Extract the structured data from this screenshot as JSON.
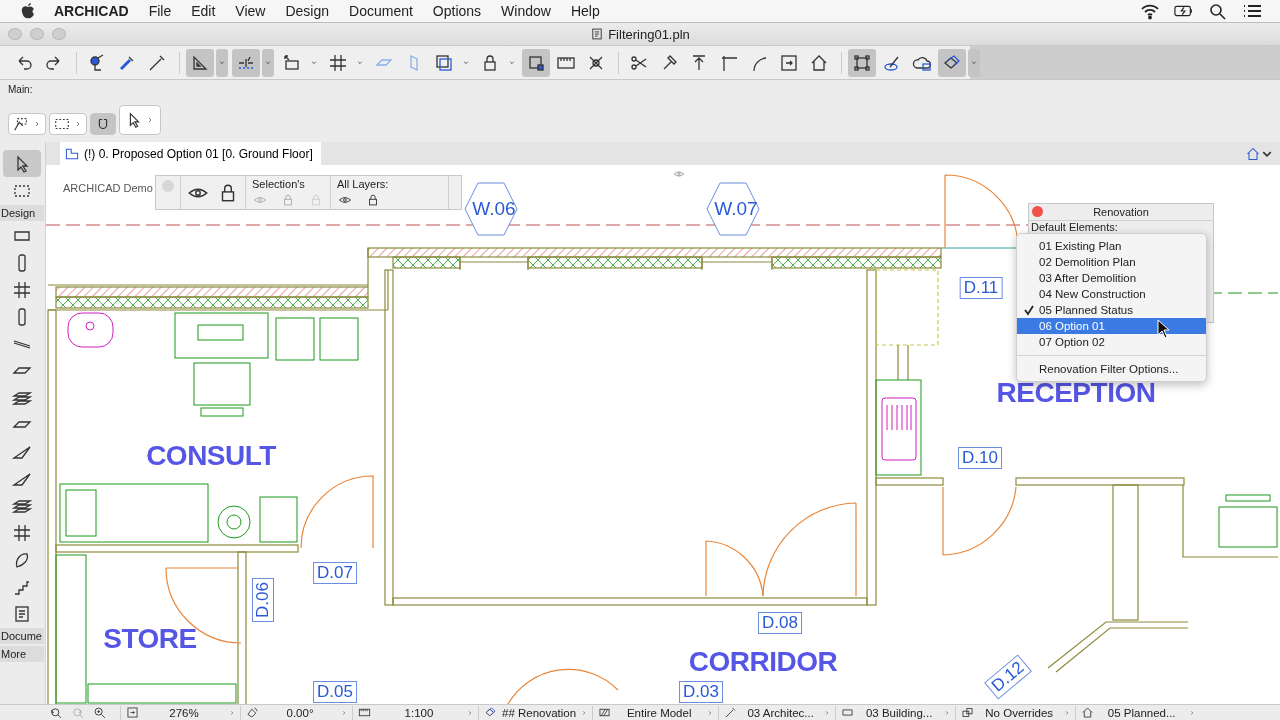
{
  "menu_bar": {
    "app_name": "ARCHICAD",
    "items": [
      "File",
      "Edit",
      "View",
      "Design",
      "Document",
      "Options",
      "Window",
      "Help"
    ]
  },
  "window": {
    "title": "Filtering01.pln"
  },
  "toolbar": {
    "buttons": [
      {
        "on": false,
        "has_menu": false
      },
      {
        "on": false,
        "has_menu": false
      },
      {
        "on": false,
        "has_menu": false
      },
      {
        "on": false,
        "has_menu": false
      },
      {
        "on": false,
        "has_menu": false
      },
      {
        "on": true,
        "has_menu": true
      },
      {
        "on": true,
        "has_menu": true
      },
      {
        "on": false,
        "has_menu": true
      },
      {
        "on": false,
        "has_menu": true
      },
      {
        "on": false,
        "has_menu": false
      },
      {
        "on": false,
        "has_menu": false
      },
      {
        "on": false,
        "has_menu": true
      },
      {
        "on": false,
        "has_menu": true
      },
      {
        "on": true,
        "has_menu": false
      },
      {
        "on": false,
        "has_menu": false
      },
      {
        "on": false,
        "has_menu": false
      },
      {
        "on": false,
        "has_menu": false
      },
      {
        "on": false,
        "has_menu": false
      },
      {
        "on": false,
        "has_menu": false
      },
      {
        "on": false,
        "has_menu": false
      },
      {
        "on": false,
        "has_menu": false
      },
      {
        "on": false,
        "has_menu": false
      },
      {
        "on": false,
        "has_menu": false
      },
      {
        "on": true,
        "has_menu": false
      },
      {
        "on": false,
        "has_menu": false
      },
      {
        "on": false,
        "has_menu": false
      },
      {
        "on": true,
        "has_menu": true
      }
    ]
  },
  "main_panel": {
    "label": "Main:",
    "tools": [
      {
        "selected": false
      },
      {
        "selected": false
      },
      {
        "selected": true
      },
      {
        "selected": false
      }
    ]
  },
  "toolbox": {
    "top_tools": [
      {
        "selected": true
      },
      {
        "selected": false
      }
    ],
    "design_label": "Design",
    "design_tools": [
      {
        "selected": false
      },
      {
        "selected": false
      },
      {
        "selected": false
      },
      {
        "selected": false
      },
      {
        "selected": false
      },
      {
        "selected": false
      },
      {
        "selected": false
      },
      {
        "selected": false
      },
      {
        "selected": false
      },
      {
        "selected": false
      },
      {
        "selected": false
      },
      {
        "selected": false
      },
      {
        "selected": false
      },
      {
        "selected": false
      },
      {
        "selected": false
      }
    ],
    "document_label": "Docume",
    "more_label": "More"
  },
  "view_tab": {
    "title": "(!) 0. Proposed Option 01 [0. Ground Floor]"
  },
  "info_box": {
    "label": "ARCHICAD Demo",
    "selection_label": "Selection's",
    "layers_label": "All Layers:"
  },
  "plan": {
    "rooms": [
      "CONSULT",
      "STORE",
      "RECEPTION",
      "CORRIDOR"
    ],
    "tags": [
      {
        "label": "W.06",
        "kind": "window"
      },
      {
        "label": "W.07",
        "kind": "window"
      },
      {
        "label": "D.11",
        "kind": "door"
      },
      {
        "label": "D.10",
        "kind": "door"
      },
      {
        "label": "D.07",
        "kind": "door"
      },
      {
        "label": "D.06",
        "kind": "door"
      },
      {
        "label": "D.08",
        "kind": "door"
      },
      {
        "label": "D.05",
        "kind": "door"
      },
      {
        "label": "D.03",
        "kind": "door"
      },
      {
        "label": "D.12",
        "kind": "door"
      }
    ]
  },
  "renovation_palette": {
    "title": "Renovation",
    "section_label": "Default Elements:",
    "menu": {
      "items": [
        {
          "label": "01 Existing Plan",
          "checked": false,
          "selected": false
        },
        {
          "label": "02 Demolition Plan",
          "checked": false,
          "selected": false
        },
        {
          "label": "03 After Demolition",
          "checked": false,
          "selected": false
        },
        {
          "label": "04 New Construction",
          "checked": false,
          "selected": false
        },
        {
          "label": "05 Planned Status",
          "checked": true,
          "selected": false
        },
        {
          "label": "06 Option 01",
          "checked": false,
          "selected": true
        },
        {
          "label": "07 Option 02",
          "checked": false,
          "selected": false
        }
      ],
      "footer": "Renovation Filter Options..."
    }
  },
  "status_bar": {
    "items": [
      {
        "label": "276%"
      },
      {
        "label": "0.00°"
      },
      {
        "label": "1:100"
      },
      {
        "label": "## Renovation"
      },
      {
        "label": "Entire Model"
      },
      {
        "label": "03 Architec..."
      },
      {
        "label": "03 Building..."
      },
      {
        "label": "No Overrides"
      },
      {
        "label": "05 Planned..."
      }
    ]
  }
}
